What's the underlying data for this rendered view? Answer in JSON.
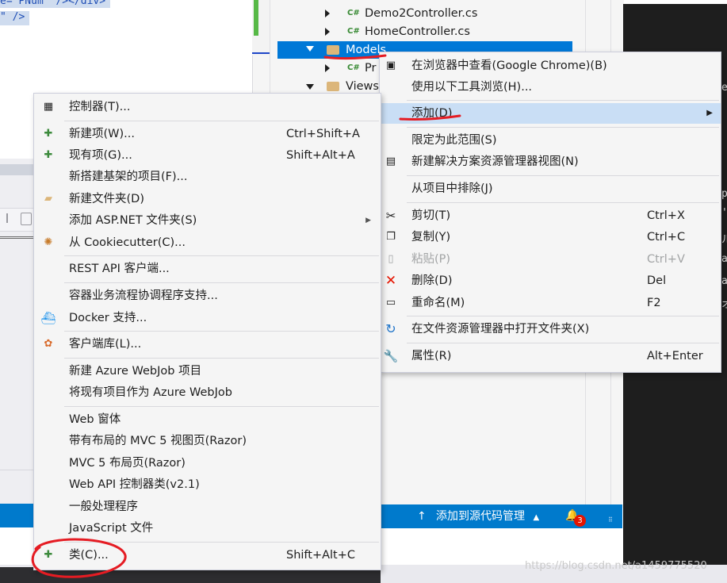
{
  "editor": {
    "line1": "e= PNum\" /></div>",
    "line2": "\" />"
  },
  "solution_explorer": {
    "items": [
      {
        "label": "Demo2Controller.cs",
        "icon": "csharp-file-icon"
      },
      {
        "label": "HomeController.cs",
        "icon": "csharp-file-icon"
      },
      {
        "label": "Models",
        "icon": "folder-icon"
      },
      {
        "label": "Pr",
        "icon": "csharp-file-icon"
      },
      {
        "label": "Views",
        "icon": "folder-icon"
      }
    ],
    "cs_tag": "C#"
  },
  "primary_menu": {
    "items": [
      {
        "label": "在浏览器中查看(Google Chrome)(B)",
        "shortcut": "",
        "icon": "browser-view-icon"
      },
      {
        "label": "使用以下工具浏览(H)...",
        "shortcut": "",
        "icon": ""
      },
      {
        "label": "添加(D)",
        "shortcut": "",
        "icon": ""
      },
      {
        "label": "限定为此范围(S)",
        "shortcut": "",
        "icon": ""
      },
      {
        "label": "新建解决方案资源管理器视图(N)",
        "shortcut": "",
        "icon": "new-view-icon"
      },
      {
        "label": "从项目中排除(J)",
        "shortcut": "",
        "icon": ""
      },
      {
        "label": "剪切(T)",
        "shortcut": "Ctrl+X",
        "icon": "scissors-icon"
      },
      {
        "label": "复制(Y)",
        "shortcut": "Ctrl+C",
        "icon": "copy-icon"
      },
      {
        "label": "粘贴(P)",
        "shortcut": "Ctrl+V",
        "icon": "paste-icon"
      },
      {
        "label": "删除(D)",
        "shortcut": "Del",
        "icon": "delete-x-icon"
      },
      {
        "label": "重命名(M)",
        "shortcut": "F2",
        "icon": "rename-icon"
      },
      {
        "label": "在文件资源管理器中打开文件夹(X)",
        "shortcut": "",
        "icon": "open-folder-arrow-icon"
      },
      {
        "label": "属性(R)",
        "shortcut": "Alt+Enter",
        "icon": "wrench-icon"
      }
    ]
  },
  "submenu": {
    "items": [
      {
        "label": "控制器(T)...",
        "shortcut": "",
        "icon": "controller-icon"
      },
      {
        "label": "新建项(W)...",
        "shortcut": "Ctrl+Shift+A",
        "icon": "new-item-icon"
      },
      {
        "label": "现有项(G)...",
        "shortcut": "Shift+Alt+A",
        "icon": "existing-item-icon"
      },
      {
        "label": "新搭建基架的项目(F)...",
        "shortcut": "",
        "icon": ""
      },
      {
        "label": "新建文件夹(D)",
        "shortcut": "",
        "icon": "new-folder-icon"
      },
      {
        "label": "添加 ASP.NET 文件夹(S)",
        "shortcut": "",
        "icon": ""
      },
      {
        "label": "从 Cookiecutter(C)...",
        "shortcut": "",
        "icon": "cookiecutter-icon"
      },
      {
        "label": "REST API 客户端...",
        "shortcut": "",
        "icon": ""
      },
      {
        "label": "容器业务流程协调程序支持...",
        "shortcut": "",
        "icon": ""
      },
      {
        "label": "Docker 支持...",
        "shortcut": "",
        "icon": "docker-icon"
      },
      {
        "label": "客户端库(L)...",
        "shortcut": "",
        "icon": "client-library-icon"
      },
      {
        "label": "新建 Azure WebJob 项目",
        "shortcut": "",
        "icon": ""
      },
      {
        "label": "将现有项目作为 Azure WebJob",
        "shortcut": "",
        "icon": ""
      },
      {
        "label": "Web 窗体",
        "shortcut": "",
        "icon": ""
      },
      {
        "label": "带有布局的 MVC 5 视图页(Razor)",
        "shortcut": "",
        "icon": ""
      },
      {
        "label": "MVC 5 布局页(Razor)",
        "shortcut": "",
        "icon": ""
      },
      {
        "label": "Web API 控制器类(v2.1)",
        "shortcut": "",
        "icon": ""
      },
      {
        "label": "一般处理程序",
        "shortcut": "",
        "icon": ""
      },
      {
        "label": "JavaScript 文件",
        "shortcut": "",
        "icon": ""
      },
      {
        "label": "类(C)...",
        "shortcut": "Shift+Alt+C",
        "icon": "class-icon"
      }
    ]
  },
  "status_bar": {
    "source_control": "添加到源代码管理",
    "notifications": "3"
  },
  "watermark": "https://blog.csdn.net/a1459775520",
  "colors": {
    "accent_blue": "#007acc",
    "selection": "#0078d7",
    "menu_highlight": "#c9def5",
    "annotation_red": "#e51c23"
  }
}
